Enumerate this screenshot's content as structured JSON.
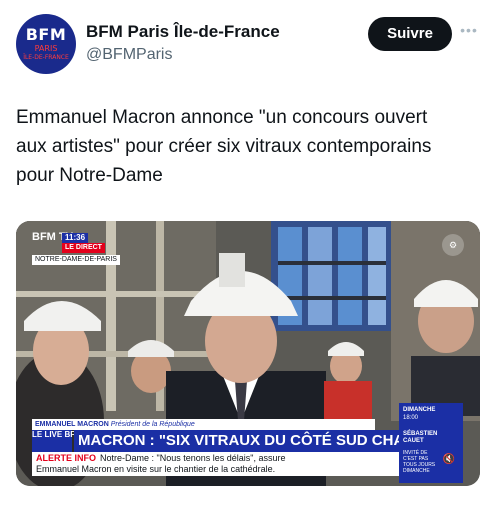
{
  "account": {
    "avatar": {
      "line1": "BFM",
      "line2": "PARIS",
      "line3": "ÎLE-DE-FRANCE"
    },
    "display_name": "BFM Paris Île-de-France",
    "handle": "@BFMParis"
  },
  "actions": {
    "follow_label": "Suivre",
    "more_icon": "more-dots-icon"
  },
  "tweet": {
    "text": "Emmanuel Macron annonce \"un concours ouvert aux artistes\" pour créer six vitraux contemporains pour Notre-Dame"
  },
  "media": {
    "channel_logo": "BFM TV.",
    "time": "11:36",
    "live_badge": "LE DIRECT",
    "location": "NOTRE-DAME-DE-PARIS",
    "speaker_name": "EMMANUEL MACRON",
    "speaker_role": "Président de la République",
    "live_tag": "LE LIVE BFM",
    "headline": "MACRON : \"SIX VITRAUX DU CÔTÉ SUD CHANGÉS\"",
    "alert_label": "ALERTE INFO",
    "alert_text_1": "Notre-Dame : \"Nous tenons les délais\", assure",
    "alert_text_2": "Emmanuel Macron en visite sur le chantier de la cathédrale.",
    "side_day": "DIMANCHE",
    "side_time": "18:00",
    "side_guest1": "SÉBASTIEN",
    "side_guest2": "CAUET",
    "side_invite": "INVITÉ DE C'EST PAS TOUS JOURS DIMANCHE",
    "mute_icon": "mute-icon",
    "gear_icon": "settings-icon"
  },
  "colors": {
    "bfm_blue": "#1b2fa5",
    "alert_red": "#e3001b",
    "follow_bg": "#0f1419"
  }
}
